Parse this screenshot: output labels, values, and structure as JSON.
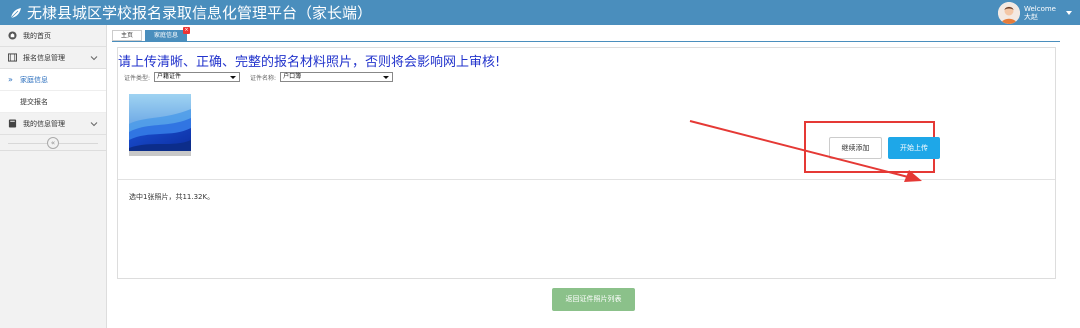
{
  "header": {
    "title": "无棣县城区学校报名录取信息化管理平台（家长端）",
    "welcome": "Welcome",
    "username": "大赵"
  },
  "sidebar": {
    "items": [
      {
        "label": "我的首页",
        "icon": "home-icon"
      },
      {
        "label": "报名信息管理",
        "icon": "film-icon"
      },
      {
        "label": "家庭信息",
        "active": true
      },
      {
        "label": "提交报名"
      },
      {
        "label": "我的信息管理",
        "icon": "book-icon"
      }
    ],
    "collapse": "«"
  },
  "tabs": [
    {
      "label": "主页"
    },
    {
      "label": "家庭信息",
      "active": true,
      "close": "×"
    }
  ],
  "main": {
    "notice": "请上传清晰、正确、完整的报名材料照片，否则将会影响网上审核!",
    "cert_type_label": "证件类型:",
    "cert_type_value": "户籍证件",
    "cert_name_label": "证件名称:",
    "cert_name_value": "户口簿",
    "status": "选中1张照片，共11.32K。",
    "continue_add": "继续添加",
    "start_upload": "开始上传",
    "back_button": "返回证件照片列表"
  },
  "colors": {
    "header_bg": "#4a8ebd",
    "notice_text": "#2233cc",
    "upload_btn": "#1ea7e8",
    "back_btn": "#8bc18a",
    "annotation": "#e53935"
  }
}
